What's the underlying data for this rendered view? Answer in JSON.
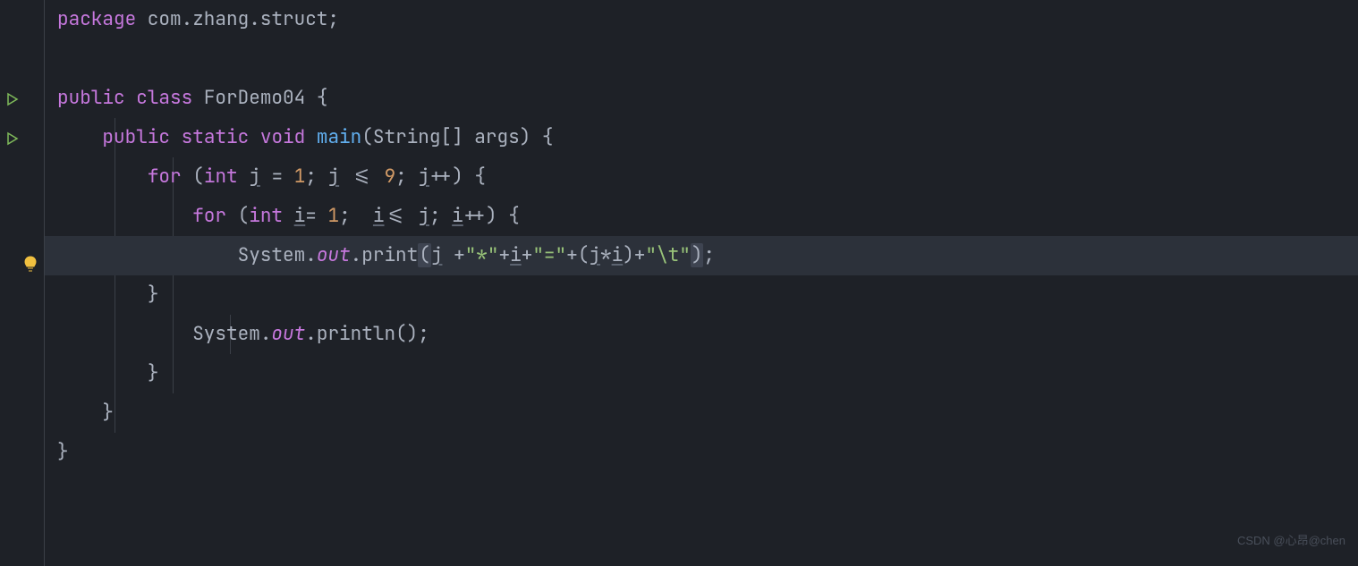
{
  "watermark": "CSDN @心昂@chen",
  "code": {
    "package_kw": "package",
    "package_name": " com.zhang.struct",
    "semi": ";",
    "public_kw": "public",
    "class_kw": "class",
    "class_name": "ForDemo04",
    "static_kw": "static",
    "void_kw": "void",
    "main_name": "main",
    "string_type": "String",
    "brackets": "[]",
    "args_name": "args",
    "for_kw": "for",
    "int_kw": "int",
    "j_var": "j",
    "i_var": "i",
    "eq": "=",
    "one": "1",
    "nine": "9",
    "le": "<=",
    "pp": "++",
    "lbrace": "{",
    "rbrace": "}",
    "lparen": "(",
    "rparen": ")",
    "system": "System",
    "dot": ".",
    "out_field": "out",
    "print_m": "print",
    "println_m": "println",
    "plus": "+",
    "star": "*",
    "star_str": "\"*\"",
    "eq_str": "\"=\"",
    "tab_str": "\"\\t\"",
    "space": " "
  }
}
